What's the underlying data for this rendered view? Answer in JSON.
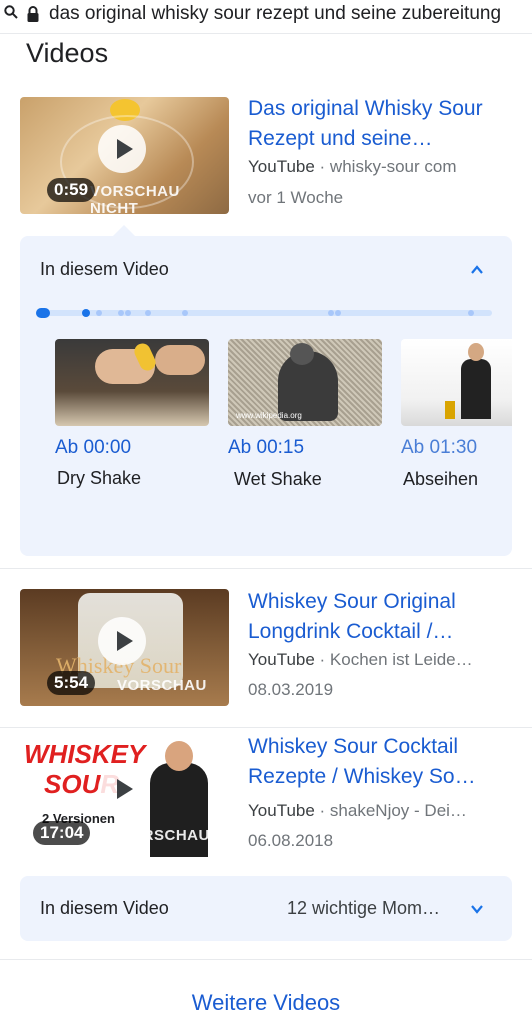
{
  "search": {
    "query": "das original whisky sour rezept und seine zubereitung"
  },
  "section": {
    "title": "Videos"
  },
  "videos": [
    {
      "title": "Das original Whisky Sour Rezept und seine…",
      "source": "YouTube",
      "channel": "· whisky-sour com",
      "date": "vor 1 Woche",
      "duration": "0:59",
      "preview_text": "VORSCHAU NICHT"
    },
    {
      "title": "Whiskey Sour Original Longdrink Cocktail /…",
      "source": "YouTube",
      "channel": "· Kochen ist Leide…",
      "date": "08.03.2019",
      "duration": "5:54",
      "preview_text": "VORSCHAU",
      "thumb_text": "Whiskey Sour"
    },
    {
      "title": "Whiskey Sour Cocktail Rezepte / Whiskey So…",
      "source": "YouTube",
      "channel": "· shakeNjoy - Dei…",
      "date": "06.08.2018",
      "duration": "17:04",
      "preview_text": "VORSCHAU",
      "thumb_text_1": "WHISKEY",
      "thumb_text_2": "SOUR",
      "thumb_text_3": "2 Versionen"
    }
  ],
  "moments_panel": {
    "label": "In diesem Video",
    "key_moments": [
      {
        "time": "Ab 00:00",
        "label": "Dry Shake"
      },
      {
        "time": "Ab 00:15",
        "label": "Wet Shake"
      },
      {
        "time": "Ab 01:30",
        "label": "Abseihen"
      }
    ],
    "thumb2_caption": "www.wikipedia.org"
  },
  "moments_panel_collapsed": {
    "label": "In diesem Video",
    "summary": "12 wichtige Mom…"
  },
  "more": {
    "label": "Weitere Videos"
  },
  "colors": {
    "link": "#1a5cd1",
    "panel_bg": "#eef3fd",
    "accent": "#1a73e8"
  }
}
